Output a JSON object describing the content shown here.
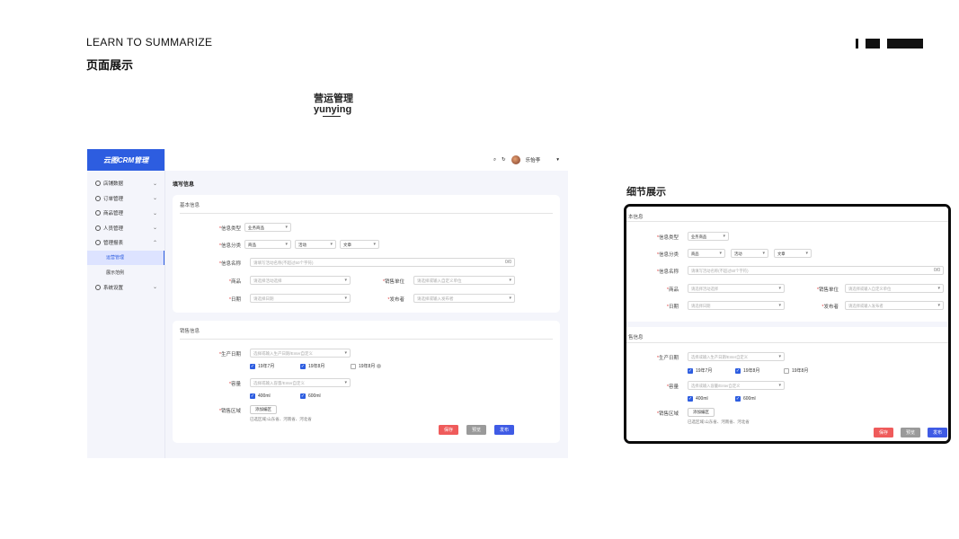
{
  "header": {
    "title_en": "LEARN TO SUMMARIZE",
    "title_cn": "页面展示"
  },
  "section": {
    "title_cn": "营运管理",
    "title_en": "yunying"
  },
  "detail": {
    "title": "细节展示"
  },
  "app": {
    "logo": "云图CRM管理",
    "user": {
      "name": "乐怡李"
    },
    "nav": [
      {
        "label": "店铺数据",
        "chev": "⌄"
      },
      {
        "label": "订单管理",
        "chev": "⌄"
      },
      {
        "label": "商品管理",
        "chev": "⌄"
      },
      {
        "label": "人员管理",
        "chev": "⌄"
      },
      {
        "label": "管理报表",
        "chev": "⌃"
      },
      {
        "label": "运营管理"
      },
      {
        "label": "展示范例"
      },
      {
        "label": "系统设置",
        "chev": "⌄"
      }
    ],
    "page_title": "填写信息",
    "basic": {
      "title": "基本信息",
      "type_label": "信息类型",
      "type_value": "业务商品",
      "cat_label": "信息分类",
      "cat_values": [
        "商品",
        "活动",
        "文章"
      ],
      "name_label": "信息名称",
      "name_placeholder": "请填写活动名称(不超过50个字符)",
      "name_count": "0/0",
      "goods_label": "商品",
      "goods_placeholder": "请选择活动选择",
      "unit_label": "销售单位",
      "unit_placeholder": "请选择或输入自定义单位",
      "date_label": "日期",
      "date_placeholder": "请选择日期",
      "pub_label": "发布者",
      "pub_placeholder": "请选择或输入发布者"
    },
    "sales": {
      "title": "销售信息",
      "prod_label": "生产日期",
      "prod_placeholder": "选择或输入生产日期/Enter自定义",
      "prod_opts": [
        "19年7月",
        "19年8月",
        "19年8月"
      ],
      "vol_label": "容量",
      "vol_placeholder": "选择或输入容量/Enter自定义",
      "vol_opts": [
        "400ml",
        "600ml"
      ],
      "area_label": "销售区域",
      "area_btn": "添加编区",
      "area_hint": "已选区域:山东省、河南省、河北省"
    },
    "buttons": {
      "save": "保存",
      "preview": "预览",
      "publish": "发布"
    }
  },
  "zoom": {
    "basic_title": "本信息",
    "sales_title": "售信息",
    "type_label": "信息类型",
    "type_value": "业务商品",
    "cat_label": "信息分类",
    "cat_values": [
      "商品",
      "活动",
      "文章"
    ],
    "name_label": "信息名称",
    "name_placeholder": "请填写活动名称(不超过50个字符)",
    "name_count": "0/0",
    "goods_label": "商品",
    "goods_placeholder": "请选择活动选择",
    "unit_label": "销售单位",
    "unit_placeholder": "请选择或输入自定义单位",
    "date_label": "日期",
    "date_placeholder": "请选择日期",
    "pub_label": "发布者",
    "pub_placeholder": "请选择或输入发布者",
    "prod_label": "生产日期",
    "prod_placeholder": "选择或输入生产日期/Enter自定义",
    "prod_opts": [
      "19年7月",
      "19年8月",
      "19年8月"
    ],
    "vol_label": "容量",
    "vol_placeholder": "选择或输入容量/Enter自定义",
    "vol_opts": [
      "400ml",
      "600ml"
    ],
    "area_label": "销售区域",
    "area_btn": "添加编区",
    "area_hint": "已选区域:山东省、河南省、河北省",
    "buttons": {
      "save": "保存",
      "preview": "预览",
      "publish": "发布"
    }
  }
}
